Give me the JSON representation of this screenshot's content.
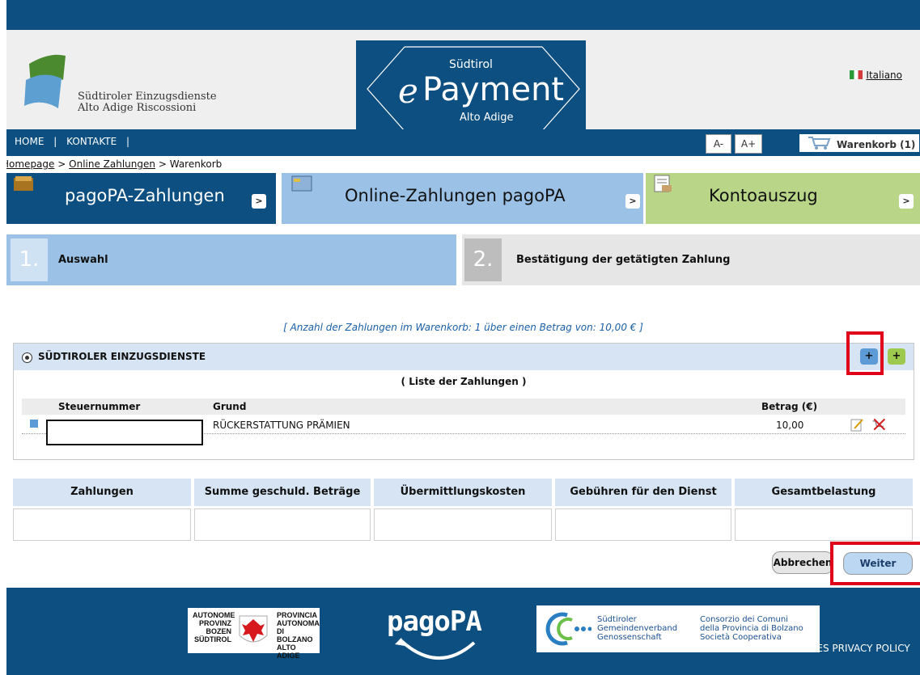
{
  "header": {
    "org_line1": "Südtiroler Einzugsdienste",
    "org_line2": "Alto Adige Riscossioni",
    "epay_top": "Südtirol",
    "epay_e": "e",
    "epay_word": "Payment",
    "epay_bottom": "Alto Adige",
    "language": "Italiano"
  },
  "nav": {
    "home": "HOME",
    "sep1": "|",
    "contacts": "KONTAKTE",
    "sep2": "|",
    "font_smaller": "A-",
    "font_larger": "A+",
    "cart": "Warenkorb (1)"
  },
  "breadcrumb": {
    "home": "Homepage",
    "sep": ">",
    "online": "Online Zahlungen",
    "current": "Warenkorb"
  },
  "tabs": [
    {
      "label": "pagoPA-Zahlungen",
      "arrow": ">"
    },
    {
      "label": "Online-Zahlungen pagoPA",
      "arrow": ">"
    },
    {
      "label": "Kontoauszug",
      "arrow": ">"
    }
  ],
  "steps": [
    {
      "number": "1.",
      "label": "Auswahl"
    },
    {
      "number": "2.",
      "label": "Bestätigung der getätigten Zahlung"
    }
  ],
  "summary": "[ Anzahl der Zahlungen im Warenkorb: 1 über einen Betrag von: 10,00 € ]",
  "panel": {
    "title": "SÜDTIROLER EINZUGSDIENSTE",
    "plus_blue": "+",
    "plus_green": "+",
    "list_title": "( Liste der Zahlungen )",
    "columns": [
      "Steuernummer",
      "Grund",
      "Betrag (€)"
    ],
    "rows": [
      {
        "steuernummer": "",
        "grund": "RÜCKERSTATTUNG PRÄMIEN",
        "betrag": "10,00"
      }
    ]
  },
  "totals": {
    "headers": [
      "Zahlungen",
      "Summe geschuld. Beträge",
      "Übermittlungskosten",
      "Gebühren für den Dienst",
      "Gesamtbelastung"
    ],
    "values": [
      "",
      "",
      "",
      "",
      ""
    ]
  },
  "buttons": {
    "cancel": "Abbrechen",
    "next": "Weiter"
  },
  "footer": {
    "prov_left": [
      "AUTONOME",
      "PROVINZ",
      "BOZEN",
      "SÜDTIROL"
    ],
    "prov_right": [
      "PROVINCIA",
      "AUTONOMA",
      "DI BOLZANO",
      "ALTO ADIGE"
    ],
    "pagopa": "pagoPA",
    "gvb_left": [
      "Südtiroler",
      "Gemeindenverband",
      "Genossenschaft"
    ],
    "gvb_right": [
      "Consorzio dei Comuni",
      "della Provincia di Bolzano",
      "Società Cooperativa"
    ],
    "policy": "KIES PRIVACY POLICY"
  },
  "colors": {
    "primary_blue": "#0d4f80",
    "light_blue": "#9bc2e6",
    "green_tab": "#b8d588",
    "highlight_red": "#e1001a"
  }
}
